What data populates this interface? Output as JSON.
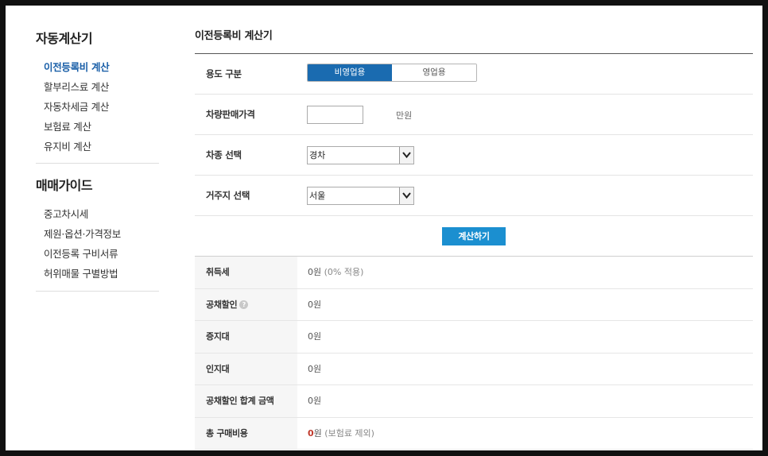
{
  "sidebar": {
    "section1_title": "자동계산기",
    "section1_items": [
      {
        "label": "이전등록비 계산",
        "active": true
      },
      {
        "label": "할부리스료 계산"
      },
      {
        "label": "자동차세금 계산"
      },
      {
        "label": "보험료 계산"
      },
      {
        "label": "유지비 계산"
      }
    ],
    "section2_title": "매매가이드",
    "section2_items": [
      {
        "label": "중고차시세"
      },
      {
        "label": "제원·옵션·가격정보"
      },
      {
        "label": "이전등록 구비서류"
      },
      {
        "label": "허위매물 구별방법"
      }
    ]
  },
  "main": {
    "title": "이전등록비 계산기",
    "form": {
      "usage": {
        "label": "용도 구분",
        "options": [
          "비영업용",
          "영업용"
        ],
        "selected": "비영업용"
      },
      "price": {
        "label": "차량판매가격",
        "value": "",
        "unit": "만원"
      },
      "car_type": {
        "label": "차종 선택",
        "value": "경차"
      },
      "region": {
        "label": "거주지 선택",
        "value": "서울"
      },
      "calc_button": "계산하기"
    },
    "results": [
      {
        "label": "취득세",
        "value": "0원",
        "note": "(0% 적용)"
      },
      {
        "label": "공채할인",
        "value": "0원",
        "help_icon": "question-icon"
      },
      {
        "label": "증지대",
        "value": "0원"
      },
      {
        "label": "인지대",
        "value": "0원"
      },
      {
        "label": "공채할인 합계 금액",
        "value": "0원"
      },
      {
        "label": "총 구매비용",
        "value_red": "0",
        "value_suffix": "원",
        "note": "(보험료 제외)"
      }
    ]
  },
  "colors": {
    "accent": "#1a6bb0",
    "button": "#1b8fd0",
    "active_link": "#1a5fa8",
    "highlight": "#c0392b"
  }
}
